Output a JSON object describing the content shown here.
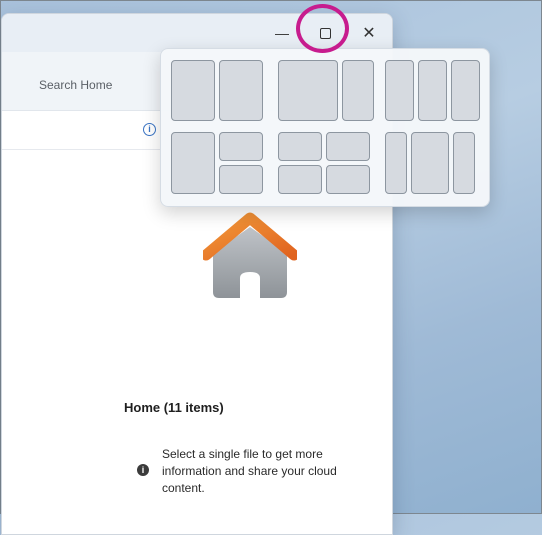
{
  "window": {
    "caption": {
      "minimize": "—",
      "close": "✕"
    },
    "search": {
      "placeholder": "Search Home"
    },
    "info_small": "i",
    "home": {
      "title": "Home (11 items)"
    },
    "details": {
      "info_glyph": "i",
      "message": "Select a single file to get more information and share your cloud content."
    }
  },
  "snap_layouts": {
    "count": 6,
    "layouts": [
      "two-equal",
      "two-wide-left",
      "three-equal",
      "left-plus-two-stacked",
      "four-grid",
      "three-columns"
    ]
  },
  "icons": {
    "home": "home-icon",
    "maximize": "maximize-icon",
    "info": "info-icon"
  },
  "colors": {
    "highlight": "#c71c8e",
    "home_roof": "#f28a2e",
    "home_body": "#a9adb2"
  }
}
